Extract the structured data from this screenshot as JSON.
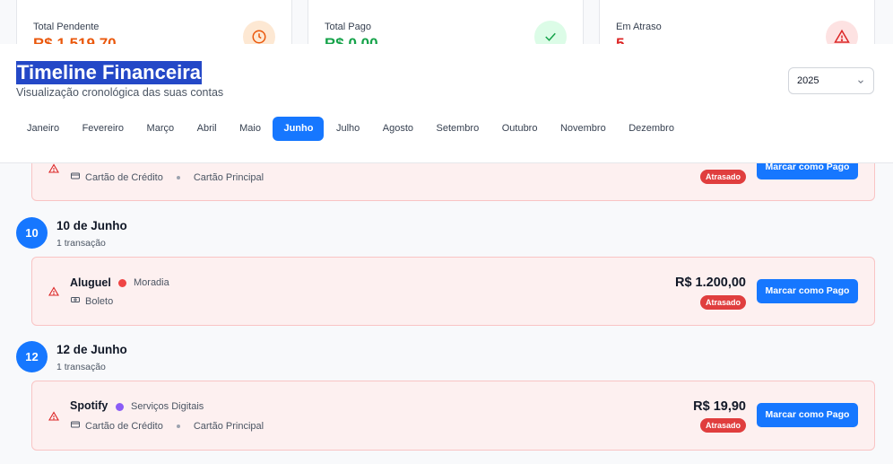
{
  "summary": [
    {
      "label": "Total Pendente",
      "value": "R$ 1.519,70",
      "color": "#ea580c",
      "icon": "clock-icon",
      "icon_bg": "#fde8d3"
    },
    {
      "label": "Total Pago",
      "value": "R$ 0,00",
      "color": "#16a34a",
      "icon": "check-icon",
      "icon_bg": "#dcfce7"
    },
    {
      "label": "Em Atraso",
      "value": "5",
      "color": "#dc2626",
      "icon": "alert-triangle-icon",
      "icon_bg": "#fde2e2"
    }
  ],
  "header": {
    "title": "Timeline Financeira",
    "subtitle": "Visualização cronológica das suas contas",
    "year": "2025"
  },
  "months": [
    "Janeiro",
    "Fevereiro",
    "Março",
    "Abril",
    "Maio",
    "Junho",
    "Julho",
    "Agosto",
    "Setembro",
    "Outubro",
    "Novembro",
    "Dezembro"
  ],
  "active_month": "Junho",
  "partial_transaction": {
    "meta": [
      "Cartão de Crédito",
      "Cartão Principal"
    ],
    "status": "Atrasado",
    "action": "Marcar como Pago"
  },
  "days": [
    {
      "day": "10",
      "title": "10 de Junho",
      "count": "1 transação",
      "transaction": {
        "name": "Aluguel",
        "category": "Moradia",
        "category_color": "#ef4444",
        "meta": [
          "Boleto"
        ],
        "meta_icon": "cash-icon",
        "amount": "R$ 1.200,00",
        "status": "Atrasado",
        "action": "Marcar como Pago"
      }
    },
    {
      "day": "12",
      "title": "12 de Junho",
      "count": "1 transação",
      "transaction": {
        "name": "Spotify",
        "category": "Serviços Digitais",
        "category_color": "#8b5cf6",
        "meta": [
          "Cartão de Crédito",
          "Cartão Principal"
        ],
        "meta_icon": "credit-card-icon",
        "amount": "R$ 19,90",
        "status": "Atrasado",
        "action": "Marcar como Pago"
      }
    }
  ]
}
